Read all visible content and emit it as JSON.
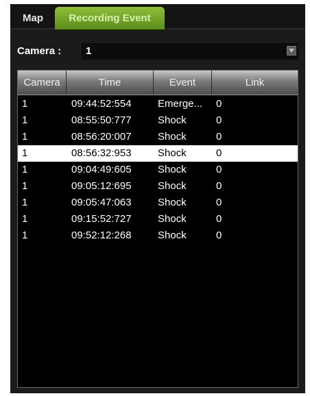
{
  "tabs": {
    "map": "Map",
    "recording_event": "Recording Event"
  },
  "camera_filter": {
    "label": "Camera :",
    "value": "1"
  },
  "table": {
    "headers": [
      "Camera",
      "Time",
      "Event",
      "Link"
    ],
    "rows": [
      {
        "camera": "1",
        "time": "09:44:52:554",
        "event": "Emerge...",
        "link": "0"
      },
      {
        "camera": "1",
        "time": "08:55:50:777",
        "event": "Shock",
        "link": "0"
      },
      {
        "camera": "1",
        "time": "08:56:20:007",
        "event": "Shock",
        "link": "0"
      },
      {
        "camera": "1",
        "time": "08:56:32:953",
        "event": "Shock",
        "link": "0"
      },
      {
        "camera": "1",
        "time": "09:04:49:605",
        "event": "Shock",
        "link": "0"
      },
      {
        "camera": "1",
        "time": "09:05:12:695",
        "event": "Shock",
        "link": "0"
      },
      {
        "camera": "1",
        "time": "09:05:47:063",
        "event": "Shock",
        "link": "0"
      },
      {
        "camera": "1",
        "time": "09:15:52:727",
        "event": "Shock",
        "link": "0"
      },
      {
        "camera": "1",
        "time": "09:52:12:268",
        "event": "Shock",
        "link": "0"
      }
    ],
    "selected_row_index": 3
  },
  "colors": {
    "active_tab": "#6fa12a",
    "panel_background": "#1b1b1b",
    "grid_background": "#000000",
    "selected_row": "#ffffff"
  }
}
